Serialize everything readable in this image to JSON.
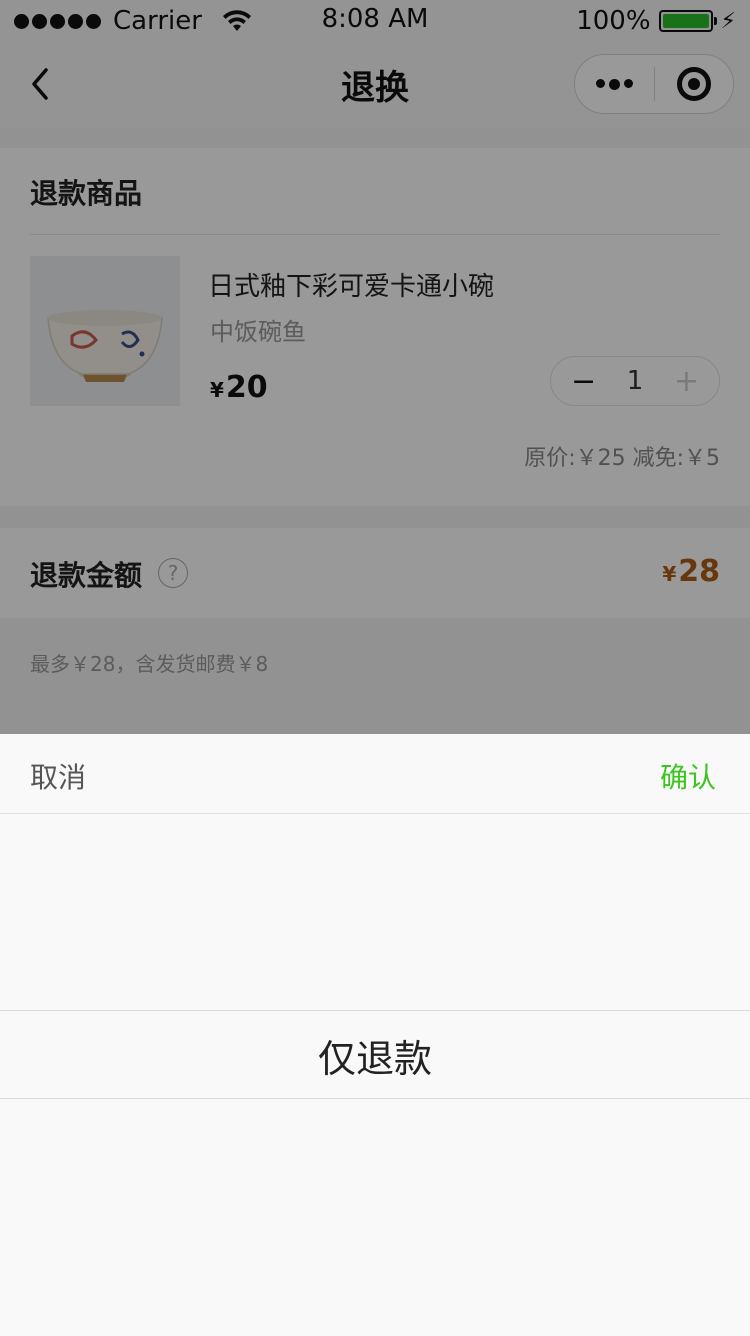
{
  "status_bar": {
    "carrier": "Carrier",
    "time": "8:08 AM",
    "battery": "100%",
    "battery_color": "#2bbd2b"
  },
  "nav": {
    "title": "退换",
    "icons": [
      "back-arrow-icon",
      "more-dots-icon",
      "target-icon"
    ]
  },
  "product_section": {
    "title": "退款商品",
    "product": {
      "name": "日式釉下彩可爱卡通小碗",
      "spec": "中饭碗鱼",
      "price_symbol": "¥",
      "price": "20",
      "quantity": "1",
      "original_price_text": "原价:￥25 减免:￥5"
    }
  },
  "refund_amount": {
    "label": "退款金额",
    "help_icon": "?",
    "value_symbol": "¥",
    "value": "28",
    "value_color": "#b05d16",
    "hint": "最多￥28，含发货邮费￥8"
  },
  "picker": {
    "cancel_label": "取消",
    "confirm_label": "确认",
    "confirm_color": "#3cc51f",
    "selected_option": "仅退款"
  }
}
